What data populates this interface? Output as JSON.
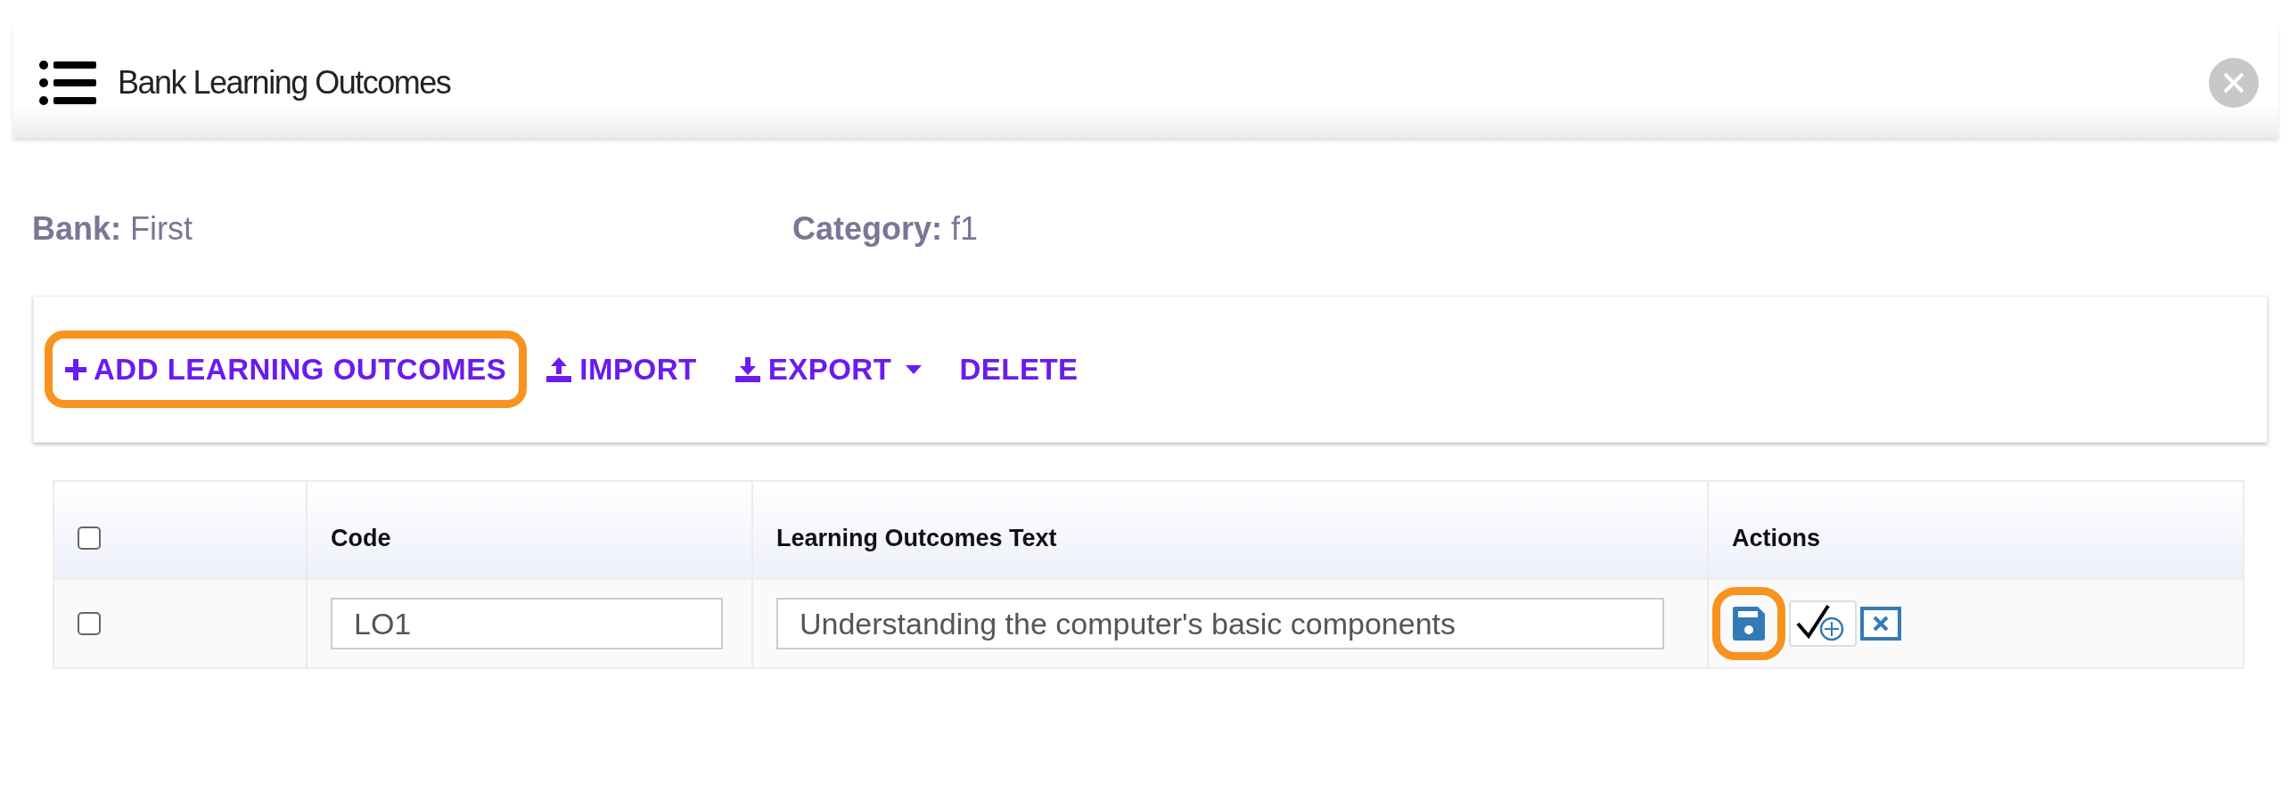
{
  "window": {
    "title": "Bank Learning Outcomes"
  },
  "info": [
    {
      "label": "Bank:",
      "value": "First"
    },
    {
      "label": "Category:",
      "value": "f1"
    }
  ],
  "toolbar": [
    {
      "kind": "add",
      "label": "ADD LEARNING OUTCOMES",
      "highlighted": true
    },
    {
      "kind": "import",
      "label": "IMPORT",
      "highlighted": false
    },
    {
      "kind": "export",
      "label": "EXPORT",
      "highlighted": false,
      "dropdown": true
    },
    {
      "kind": "delete",
      "label": "DELETE",
      "highlighted": false
    }
  ],
  "table": {
    "select_all_checked": false,
    "columns": [
      "Code",
      "Learning Outcomes Text",
      "Actions"
    ],
    "rows": [
      {
        "checked": false,
        "code": "LO1",
        "text": "Understanding the computer's basic components",
        "actions": [
          {
            "kind": "save",
            "highlighted": true
          },
          {
            "kind": "approve",
            "highlighted": false
          },
          {
            "kind": "cancel",
            "highlighted": false
          }
        ]
      }
    ]
  }
}
